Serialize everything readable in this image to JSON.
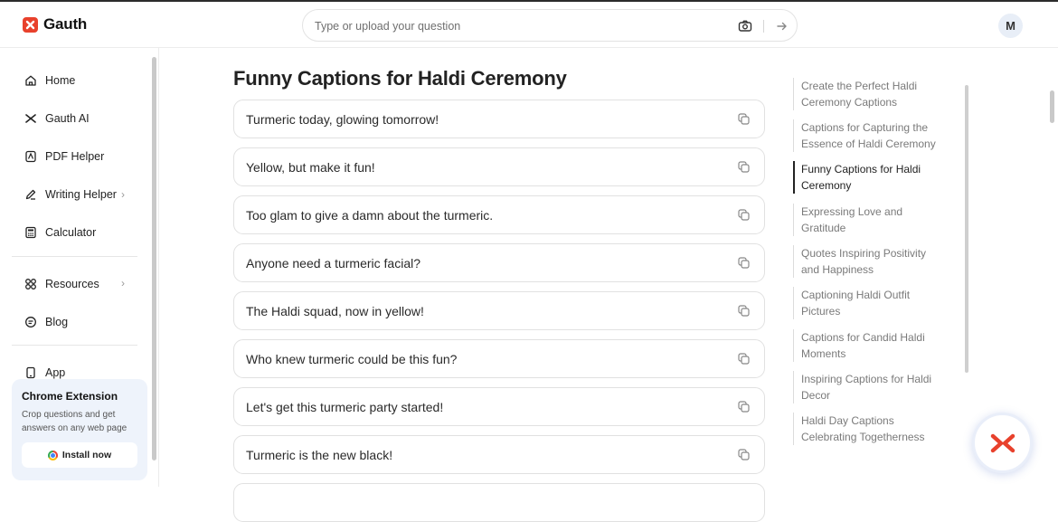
{
  "app": {
    "name": "Gauth",
    "brand_color": "#e8412c"
  },
  "search": {
    "placeholder": "Type or upload your question",
    "value": ""
  },
  "user": {
    "avatar_initial": "M"
  },
  "sidebar": {
    "items": [
      {
        "label": "Home",
        "icon": "home-icon"
      },
      {
        "label": "Gauth AI",
        "icon": "gauth-ai-icon"
      },
      {
        "label": "PDF Helper",
        "icon": "pdf-icon"
      },
      {
        "label": "Writing Helper",
        "icon": "pen-icon",
        "has_submenu": true
      },
      {
        "label": "Calculator",
        "icon": "calculator-icon"
      },
      {
        "label": "Resources",
        "icon": "grid-icon",
        "has_submenu": true
      },
      {
        "label": "Blog",
        "icon": "blog-icon"
      },
      {
        "label": "App",
        "icon": "phone-icon"
      }
    ],
    "extension": {
      "title": "Chrome Extension",
      "description": "Crop questions and get answers on any web page",
      "button_label": "Install now"
    }
  },
  "main": {
    "title": "Funny Captions for Haldi Ceremony",
    "captions": [
      "Turmeric today, glowing tomorrow!",
      "Yellow, but make it fun!",
      "Too glam to give a damn about the turmeric.",
      "Anyone need a turmeric facial?",
      "The Haldi squad, now in yellow!",
      "Who knew turmeric could be this fun?",
      "Let's get this turmeric party started!",
      "Turmeric is the new black!"
    ]
  },
  "toc": {
    "items": [
      "Create the Perfect Haldi Ceremony Captions",
      "Captions for Capturing the Essence of Haldi Ceremony",
      "Funny Captions for Haldi Ceremony",
      "Expressing Love and Gratitude",
      "Quotes Inspiring Positivity and Happiness",
      "Captioning Haldi Outfit Pictures",
      "Captions for Candid Haldi Moments",
      "Inspiring Captions for Haldi Decor",
      "Haldi Day Captions Celebrating Togetherness"
    ],
    "active_index": 2
  }
}
